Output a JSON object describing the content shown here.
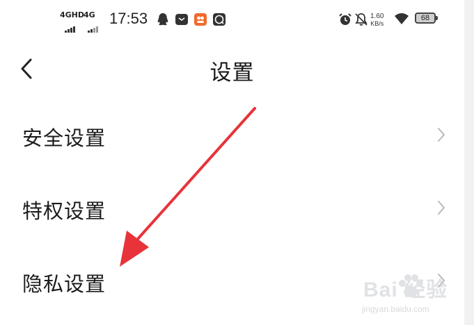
{
  "status_bar": {
    "network_1": "4GHD",
    "network_2": "4G",
    "time": "17:53",
    "speed_value": "1.60",
    "speed_unit": "KB/s",
    "battery": "68",
    "icons": [
      "qq-icon",
      "mail-icon",
      "app-icon",
      "chat-icon",
      "alarm-icon",
      "mute-icon",
      "wifi-icon",
      "battery-icon"
    ]
  },
  "header": {
    "title": "设置",
    "back_icon": "chevron-left-icon"
  },
  "menu": {
    "items": [
      {
        "label": "安全设置",
        "icon": "chevron-right-icon"
      },
      {
        "label": "特权设置",
        "icon": "chevron-right-icon"
      },
      {
        "label": "隐私设置",
        "icon": "chevron-right-icon"
      }
    ]
  },
  "annotation": {
    "arrow_color": "#e8333a",
    "points_to": "隐私设置"
  },
  "watermark": {
    "main": "Bai 经验",
    "sub": "jingyan.baidu.com"
  }
}
